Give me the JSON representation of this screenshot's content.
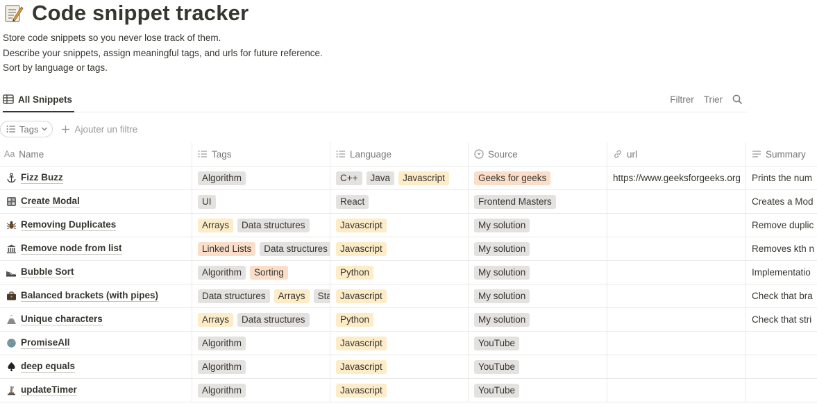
{
  "page": {
    "title": "Code snippet tracker",
    "emoji": "memo-icon",
    "description": [
      "Store code snippets so you never lose track of them.",
      "Describe your snippets, assign meaningful tags, and urls for future reference.",
      "Sort by language or tags."
    ]
  },
  "view": {
    "tab_label": "All Snippets",
    "filter_label": "Filtrer",
    "sort_label": "Trier"
  },
  "filters": {
    "tags_chip": "Tags",
    "add_filter": "Ajouter un filtre"
  },
  "columns": {
    "name": "Name",
    "tags": "Tags",
    "language": "Language",
    "source": "Source",
    "url": "url",
    "summary": "Summary"
  },
  "colors": {
    "gray_tag": "#e3e2e0",
    "orange_tag": "#fadec9",
    "yellow_tag": "#fdecc8",
    "text": "#37352f",
    "muted": "#787774"
  },
  "rows": [
    {
      "icon": "anchor-icon",
      "name": "Fizz Buzz",
      "tags": [
        {
          "t": "Algorithm",
          "c": "gray"
        }
      ],
      "language": [
        {
          "t": "C++",
          "c": "gray"
        },
        {
          "t": "Java",
          "c": "gray"
        },
        {
          "t": "Javascript",
          "c": "yellow"
        }
      ],
      "source": [
        {
          "t": "Geeks for geeks",
          "c": "orange"
        }
      ],
      "url": "https://www.geeksforgeeks.org",
      "summary": "Prints the num"
    },
    {
      "icon": "grid-icon",
      "name": "Create Modal",
      "tags": [
        {
          "t": "UI",
          "c": "gray"
        }
      ],
      "language": [
        {
          "t": "React",
          "c": "gray"
        }
      ],
      "source": [
        {
          "t": "Frontend Masters",
          "c": "gray"
        }
      ],
      "url": "",
      "summary": "Creates a Mod"
    },
    {
      "icon": "bug-icon",
      "name": "Removing Duplicates",
      "tags": [
        {
          "t": "Arrays",
          "c": "yellow"
        },
        {
          "t": "Data structures",
          "c": "gray"
        }
      ],
      "language": [
        {
          "t": "Javascript",
          "c": "yellow"
        }
      ],
      "source": [
        {
          "t": "My solution",
          "c": "gray"
        }
      ],
      "url": "",
      "summary": "Remove duplic"
    },
    {
      "icon": "bank-icon",
      "name": "Remove node from list",
      "tags": [
        {
          "t": "Linked Lists",
          "c": "orange"
        },
        {
          "t": "Data structures",
          "c": "gray"
        }
      ],
      "language": [
        {
          "t": "Javascript",
          "c": "yellow"
        }
      ],
      "source": [
        {
          "t": "My solution",
          "c": "gray"
        }
      ],
      "url": "",
      "summary": "Removes kth n"
    },
    {
      "icon": "shoe-icon",
      "name": "Bubble Sort",
      "tags": [
        {
          "t": "Algorithm",
          "c": "gray"
        },
        {
          "t": "Sorting",
          "c": "orange"
        }
      ],
      "language": [
        {
          "t": "Python",
          "c": "yellow"
        }
      ],
      "source": [
        {
          "t": "My solution",
          "c": "gray"
        }
      ],
      "url": "",
      "summary": "Implementatio"
    },
    {
      "icon": "briefcase-icon",
      "name": "Balanced brackets (with pipes)",
      "tags": [
        {
          "t": "Data structures",
          "c": "gray"
        },
        {
          "t": "Arrays",
          "c": "yellow"
        },
        {
          "t": "Sta",
          "c": "gray"
        }
      ],
      "language": [
        {
          "t": "Javascript",
          "c": "yellow"
        }
      ],
      "source": [
        {
          "t": "My solution",
          "c": "gray"
        }
      ],
      "url": "",
      "summary": "Check that bra"
    },
    {
      "icon": "volcano-icon",
      "name": "Unique characters",
      "tags": [
        {
          "t": "Arrays",
          "c": "yellow"
        },
        {
          "t": "Data structures",
          "c": "gray"
        }
      ],
      "language": [
        {
          "t": "Python",
          "c": "yellow"
        }
      ],
      "source": [
        {
          "t": "My solution",
          "c": "gray"
        }
      ],
      "url": "",
      "summary": "Check that stri"
    },
    {
      "icon": "globe-icon",
      "name": "PromiseAll",
      "tags": [
        {
          "t": "Algorithm",
          "c": "gray"
        }
      ],
      "language": [
        {
          "t": "Javascript",
          "c": "yellow"
        }
      ],
      "source": [
        {
          "t": "YouTube",
          "c": "gray"
        }
      ],
      "url": "",
      "summary": ""
    },
    {
      "icon": "spade-icon",
      "name": "deep equals",
      "tags": [
        {
          "t": "Algorithm",
          "c": "gray"
        }
      ],
      "language": [
        {
          "t": "Javascript",
          "c": "yellow"
        }
      ],
      "source": [
        {
          "t": "YouTube",
          "c": "gray"
        }
      ],
      "url": "",
      "summary": ""
    },
    {
      "icon": "statue-icon",
      "name": "updateTimer",
      "tags": [
        {
          "t": "Algorithm",
          "c": "gray"
        }
      ],
      "language": [
        {
          "t": "Javascript",
          "c": "yellow"
        }
      ],
      "source": [
        {
          "t": "YouTube",
          "c": "gray"
        }
      ],
      "url": "",
      "summary": ""
    }
  ]
}
